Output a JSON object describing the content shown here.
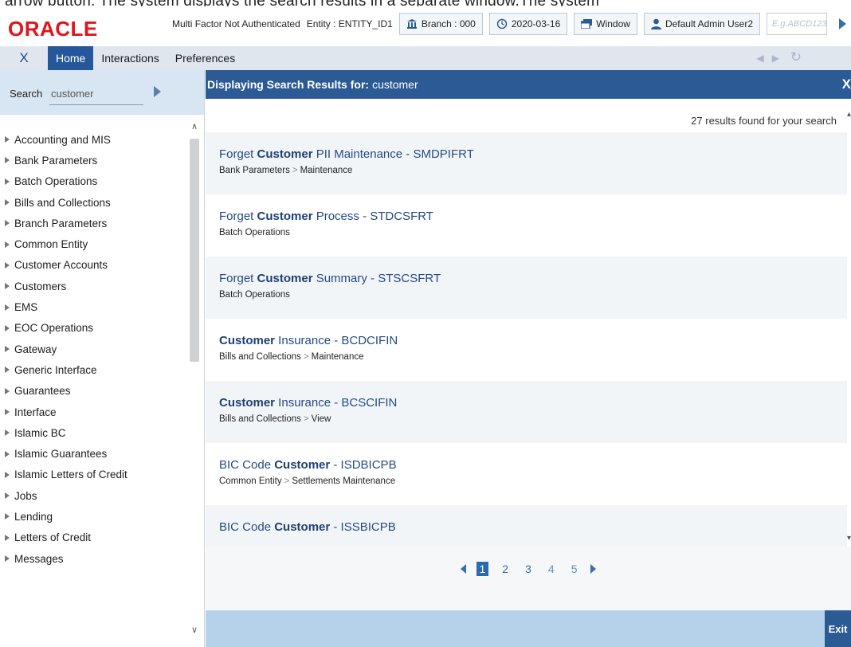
{
  "top_cut_text": "arrow button. The system displays the search results in a separate window.The system",
  "header": {
    "logo": "ORACLE",
    "auth_status": "Multi Factor Not Authenticated",
    "entity": "Entity : ENTITY_ID1",
    "branch": "Branch : 000",
    "date": "2020-03-16",
    "window_label": "Window",
    "user": "Default Admin User2",
    "input_placeholder": "E.g.ABCD123"
  },
  "menubar": {
    "close": "X",
    "tabs": [
      "Home",
      "Interactions",
      "Preferences"
    ]
  },
  "sidebar": {
    "search_label": "Search",
    "search_value": "customer",
    "items": [
      "Accounting and MIS",
      "Bank Parameters",
      "Batch Operations",
      "Bills and Collections",
      "Branch Parameters",
      "Common Entity",
      "Customer Accounts",
      "Customers",
      "EMS",
      "EOC Operations",
      "Gateway",
      "Generic Interface",
      "Guarantees",
      "Interface",
      "Islamic BC",
      "Islamic Guarantees",
      "Islamic Letters of Credit",
      "Jobs",
      "Lending",
      "Letters of Credit",
      "Messages"
    ]
  },
  "main": {
    "header_label": "Displaying Search Results for:",
    "header_query": "customer",
    "close": "X",
    "results_count": "27  results found for your search",
    "results": [
      {
        "pre": "Forget ",
        "bold": "Customer",
        "post": " PII Maintenance - SMDPIFRT",
        "path": [
          "Bank Parameters",
          "Maintenance"
        ]
      },
      {
        "pre": "Forget ",
        "bold": "Customer",
        "post": " Process - STDCSFRT",
        "path": [
          "Batch Operations"
        ]
      },
      {
        "pre": "Forget ",
        "bold": "Customer",
        "post": " Summary - STSCSFRT",
        "path": [
          "Batch Operations"
        ]
      },
      {
        "pre": "",
        "bold": "Customer",
        "post": " Insurance - BCDCIFIN",
        "path": [
          "Bills and Collections",
          "Maintenance"
        ]
      },
      {
        "pre": "",
        "bold": "Customer",
        "post": " Insurance - BCSCIFIN",
        "path": [
          "Bills and Collections",
          "View"
        ]
      },
      {
        "pre": "BIC Code ",
        "bold": "Customer",
        "post": " - ISDBICPB",
        "path": [
          "Common Entity",
          "Settlements Maintenance"
        ]
      },
      {
        "pre": "BIC Code ",
        "bold": "Customer",
        "post": " - ISSBICPB",
        "path": []
      }
    ],
    "pages": [
      "1",
      "2",
      "3",
      "4",
      "5"
    ],
    "active_page": "1",
    "exit_label": "Exit"
  }
}
